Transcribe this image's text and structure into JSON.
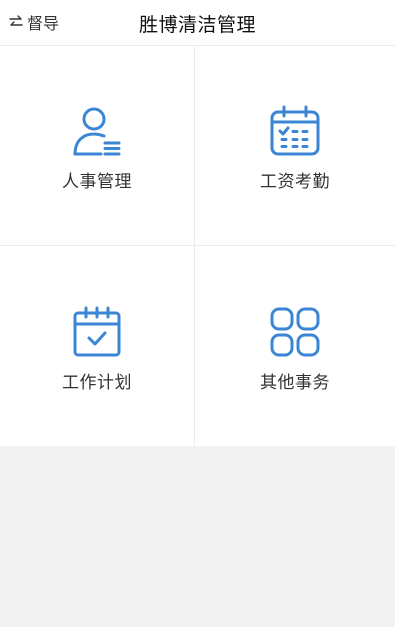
{
  "header": {
    "switch_icon": "swap-arrows-icon",
    "switch_label": "督导",
    "title": "胜博清洁管理"
  },
  "menu": {
    "items": [
      {
        "label": "人事管理",
        "icon": "person-list-icon"
      },
      {
        "label": "工资考勤",
        "icon": "calendar-grid-icon"
      },
      {
        "label": "工作计划",
        "icon": "calendar-check-icon"
      },
      {
        "label": "其他事务",
        "icon": "apps-grid-icon"
      }
    ]
  },
  "colors": {
    "accent": "#3a86d4",
    "background": "#f2f2f2",
    "surface": "#ffffff",
    "divider": "#ececec",
    "text": "#333333"
  }
}
